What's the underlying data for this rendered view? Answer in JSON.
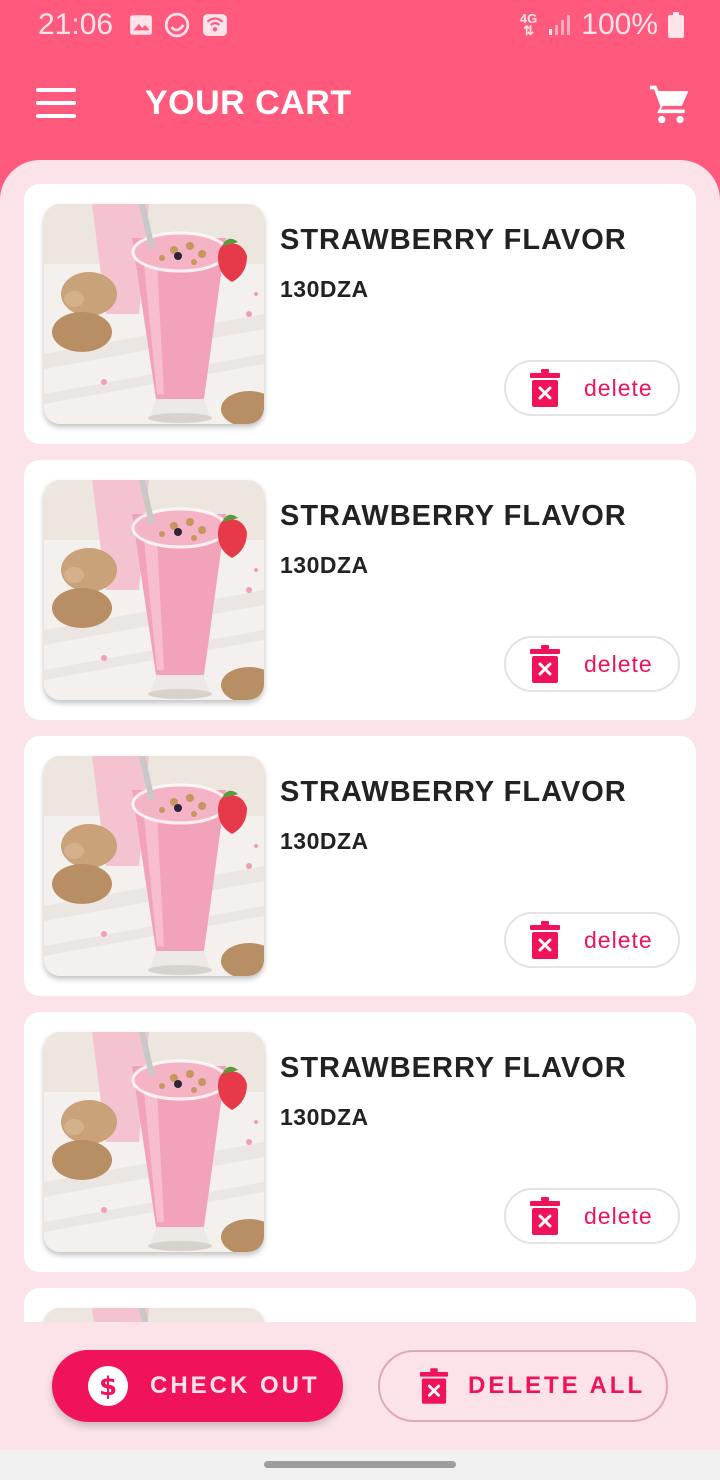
{
  "status_bar": {
    "time": "21:06",
    "network": "4G",
    "battery": "100%",
    "icons": [
      "gallery-icon",
      "whatsapp-icon",
      "wifi-icon",
      "signal-icon",
      "battery-icon"
    ]
  },
  "app_bar": {
    "title": "YOUR CART",
    "icons": [
      "menu-icon",
      "cart-icon"
    ]
  },
  "cart": {
    "items": [
      {
        "name": "STRAWBERRY FLAVOR",
        "price": "130DZA",
        "delete_label": "delete"
      },
      {
        "name": "STRAWBERRY FLAVOR",
        "price": "130DZA",
        "delete_label": "delete"
      },
      {
        "name": "STRAWBERRY FLAVOR",
        "price": "130DZA",
        "delete_label": "delete"
      },
      {
        "name": "STRAWBERRY FLAVOR",
        "price": "130DZA",
        "delete_label": "delete"
      },
      {
        "name": "",
        "price": "",
        "delete_label": ""
      }
    ]
  },
  "actions": {
    "checkout_label": "CHECK OUT",
    "delete_all_label": "DELETE ALL"
  },
  "colors": {
    "primary": "#ff5a7e",
    "accent": "#f0125a",
    "background": "#fbe3e9"
  }
}
